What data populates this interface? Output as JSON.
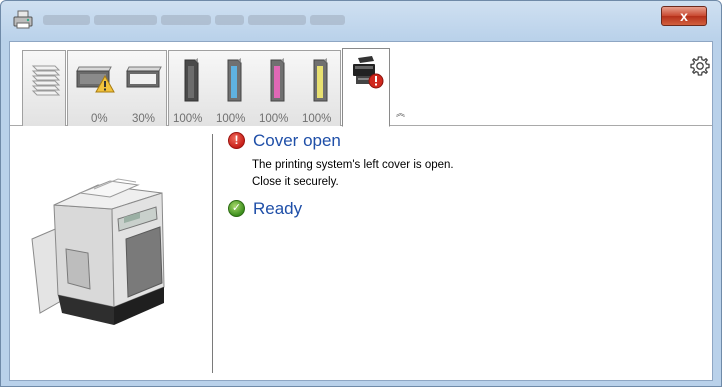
{
  "window": {
    "title": "",
    "close_label": "x"
  },
  "toolbar": {
    "waste_levels": [
      "0%",
      "30%"
    ],
    "toner_levels": [
      {
        "color": "black",
        "swatch": "#4a4a4a",
        "value": "100%"
      },
      {
        "color": "cyan",
        "swatch": "#5fb2e0",
        "value": "100%"
      },
      {
        "color": "magenta",
        "swatch": "#e068b5",
        "value": "100%"
      },
      {
        "color": "yellow",
        "swatch": "#e8e070",
        "value": "100%"
      }
    ],
    "icons": {
      "paper": "paper-stack-icon",
      "waste": "waste-toner-icon",
      "warning": "warning-icon",
      "active_tab": "printer-error-icon",
      "collapse": "chevron-up-icon",
      "settings": "gear-icon"
    },
    "collapse_glyph": "︽"
  },
  "status": {
    "error_title": "Cover open",
    "error_desc_1": "The printing system's left cover is open.",
    "error_desc_2": "Close it securely.",
    "ready_title": "Ready"
  },
  "colors": {
    "status_title": "#1f4fa8",
    "error": "#c8201a",
    "ok": "#3d8f1d",
    "close_button": "#c8482f"
  }
}
